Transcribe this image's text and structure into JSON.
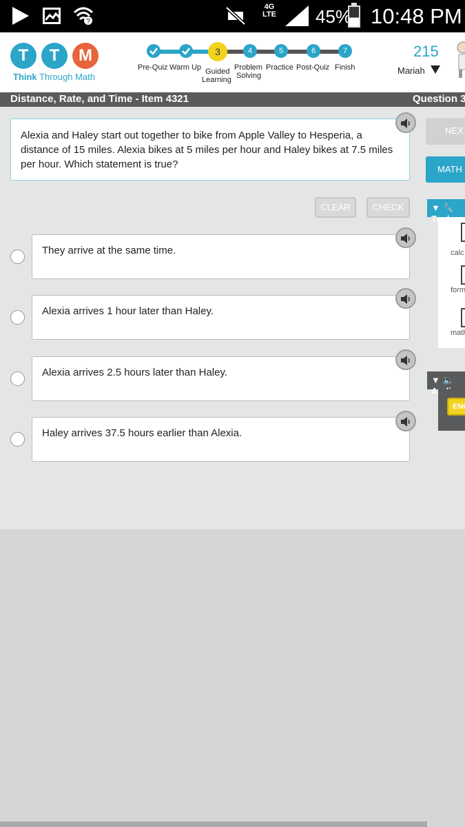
{
  "status_bar": {
    "network": "4G LTE",
    "battery": "45%",
    "time": "10:48 PM",
    "icons": [
      "play-store-icon",
      "gallery-icon",
      "wifi-icon",
      "mute-icon",
      "signal-icon",
      "battery-icon"
    ]
  },
  "header": {
    "logo_letters": [
      "T",
      "T",
      "M"
    ],
    "logo_text_bold": "Think",
    "logo_text_rest": " Through Math",
    "steps": [
      {
        "number": "1",
        "label": "Pre-Quiz",
        "status": "complete"
      },
      {
        "number": "2",
        "label": "Warm Up",
        "status": "complete"
      },
      {
        "number": "3",
        "label": "Guided Learning",
        "status": "current"
      },
      {
        "number": "4",
        "label": "Problem Solving",
        "status": "pending"
      },
      {
        "number": "5",
        "label": "Practice",
        "status": "pending"
      },
      {
        "number": "6",
        "label": "Post-Quiz",
        "status": "pending"
      },
      {
        "number": "7",
        "label": "Finish",
        "status": "pending"
      }
    ],
    "step_labels": {
      "prequiz": "Pre-Quiz",
      "warmup": "Warm Up",
      "guided_1": "Guided",
      "guided_2": "Learning",
      "problem_1": "Problem",
      "problem_2": "Solving",
      "practice": "Practice",
      "postquiz": "Post-Quiz",
      "finish": "Finish"
    },
    "step_numbers": {
      "s3": "3",
      "s4": "4",
      "s5": "5",
      "s6": "6",
      "s7": "7"
    },
    "score": "215",
    "user_name": "Mariah"
  },
  "titlebar": {
    "title": "Distance, Rate, and Time - Item 4321",
    "question_label": "Question 3"
  },
  "question": {
    "text": "Alexia and Haley start out together to bike from Apple Valley to Hesperia, a distance of 15 miles. Alexia bikes at 5 miles per hour and Haley bikes at 7.5 miles per hour. Which statement is true?"
  },
  "actions": {
    "clear": "CLEAR",
    "check": "CHECK"
  },
  "answers": [
    "They arrive at the same time.",
    "Alexia arrives 1 hour later than Haley.",
    "Alexia arrives 2.5 hours later than Haley.",
    "Haley arrives 37.5 hours earlier than Alexia."
  ],
  "sidebar": {
    "next": "NEXT",
    "math": "MATH",
    "tools_title": "Tools",
    "tools": [
      "calc",
      "form",
      "math"
    ],
    "audio_title": "Audio",
    "audio_lang": "ENG"
  },
  "colors": {
    "accent": "#2ba5c8",
    "current_step": "#f2d31d",
    "logo_m": "#e8643a",
    "titlebar": "#595b5c"
  }
}
